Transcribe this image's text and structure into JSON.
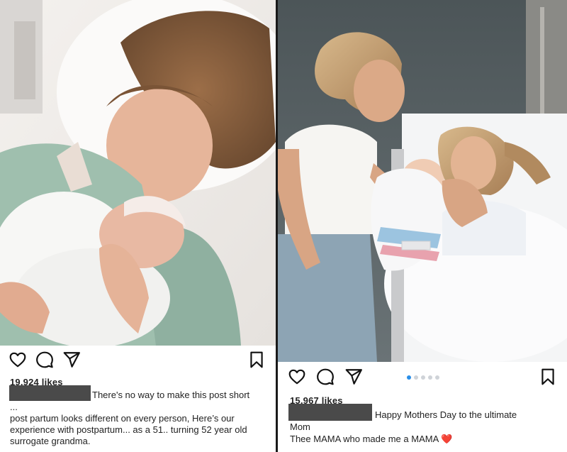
{
  "left_post": {
    "likes": "19,924 likes",
    "caption_first": "There's no way to make this post short",
    "ellipsis": "...",
    "caption_body": "post partum looks different on every person, Here’s our experience with postpartum... as a 51.. turning 52 year old surrogate grandma.",
    "icons": [
      "heart-outline-icon",
      "comment-icon",
      "share-icon",
      "bookmark-icon"
    ]
  },
  "right_post": {
    "likes": "15,967 likes",
    "caption_first": "Happy Mothers Day to the ultimate",
    "caption_wrap": "Mom",
    "caption_body": "Thee MAMA who made me a MAMA",
    "heart_emoji": "❤️",
    "carousel_dots": 5,
    "carousel_active": 1,
    "icons": [
      "heart-outline-icon",
      "comment-icon",
      "share-icon",
      "bookmark-icon"
    ]
  },
  "colors": {
    "accent_dot": "#2a8ee8",
    "redaction": "#4a4a4a",
    "heart": "#e0263a"
  }
}
